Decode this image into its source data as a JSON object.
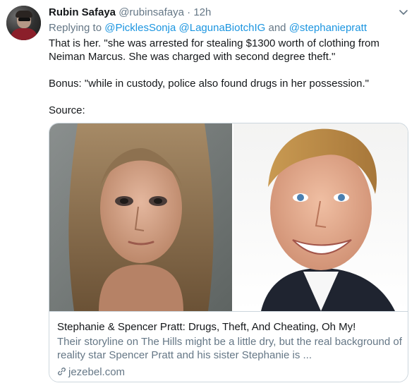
{
  "tweet": {
    "author_name": "Rubin Safaya",
    "author_handle": "@rubinsafaya",
    "separator": "·",
    "time": "12h",
    "replying_prefix": "Replying to",
    "replying_to": [
      "@PicklesSonja",
      "@LagunaBiotchIG"
    ],
    "replying_and": "and",
    "replying_last": "@stephaniepratt",
    "paragraphs": [
      "That is her.  \"she was arrested for stealing $1300 worth of clothing from Neiman Marcus. She was charged with second degree theft.\"",
      "Bonus: \"while in custody, police also found drugs in her possession.\"",
      "Source:"
    ]
  },
  "card": {
    "title": "Stephanie & Spencer Pratt: Drugs, Theft, And Cheating, Oh My!",
    "description": "Their storyline on The Hills might be a little dry, but the real background of reality star Spencer Pratt and his sister Stephanie is ...",
    "domain": "jezebel.com"
  },
  "icons": {
    "caret": "chevron-down-icon",
    "link": "link-icon"
  },
  "colors": {
    "link_blue": "#1b95e0",
    "secondary_text": "#657786",
    "border": "#ccd6dd"
  }
}
